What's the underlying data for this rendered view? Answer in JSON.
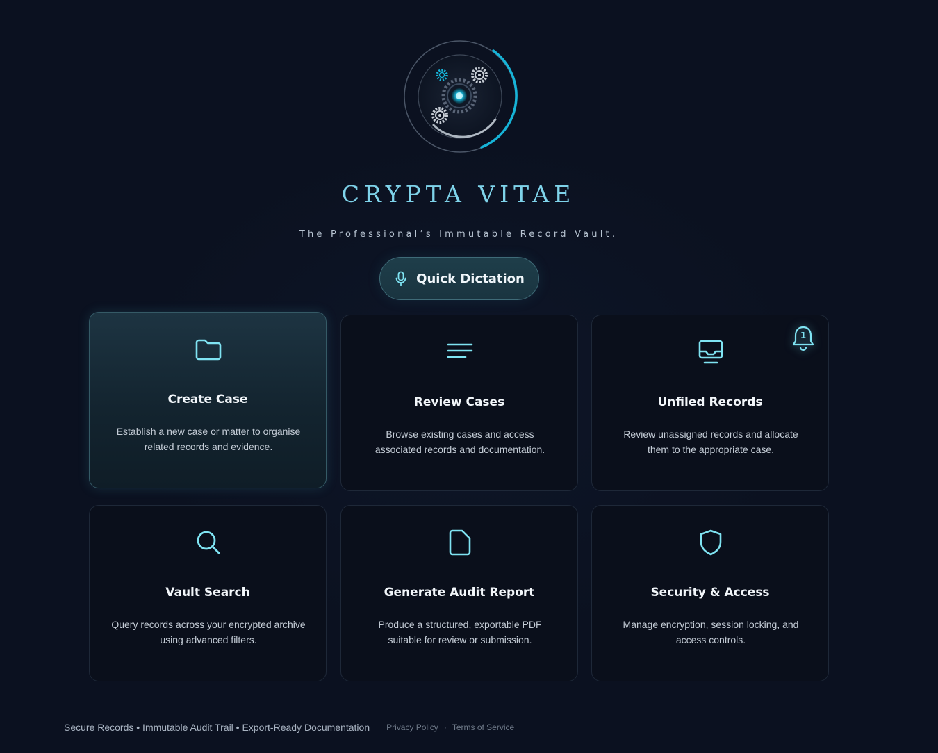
{
  "app": {
    "title": "CRYPTA VITAE",
    "tagline": "The Professional’s Immutable Record Vault."
  },
  "colors": {
    "background": "#0b1120",
    "accent": "#7fe3f2",
    "title": "#7fd3ea",
    "ring_accent": "#16b4d8"
  },
  "quick_dictation": {
    "label": "Quick Dictation",
    "icon": "microphone-icon"
  },
  "cards": [
    {
      "id": "create-case",
      "title": "Create Case",
      "description": "Establish a new case or matter to organise related records and evidence.",
      "icon": "folder-icon",
      "active": true
    },
    {
      "id": "review-cases",
      "title": "Review Cases",
      "description": "Browse existing cases and access associated records and documentation.",
      "icon": "list-lines-icon"
    },
    {
      "id": "unfiled-records",
      "title": "Unfiled Records",
      "description": "Review unassigned records and allocate them to the appropriate case.",
      "icon": "inbox-tray-icon",
      "notification": {
        "icon": "bell-icon",
        "count": "1"
      }
    },
    {
      "id": "vault-search",
      "title": "Vault Search",
      "description": "Query records across your encrypted archive using advanced filters.",
      "icon": "search-icon"
    },
    {
      "id": "generate-audit-report",
      "title": "Generate Audit Report",
      "description": "Produce a structured, exportable PDF suitable for review or submission.",
      "icon": "document-icon"
    },
    {
      "id": "security-access",
      "title": "Security & Access",
      "description": "Manage encryption, session locking, and access controls.",
      "icon": "shield-icon"
    }
  ],
  "footer": {
    "tagline": "Secure Records • Immutable Audit Trail • Export-Ready Documentation",
    "links": [
      {
        "label": "Privacy Policy"
      },
      {
        "label": "Terms of Service"
      }
    ],
    "separator": "·"
  }
}
